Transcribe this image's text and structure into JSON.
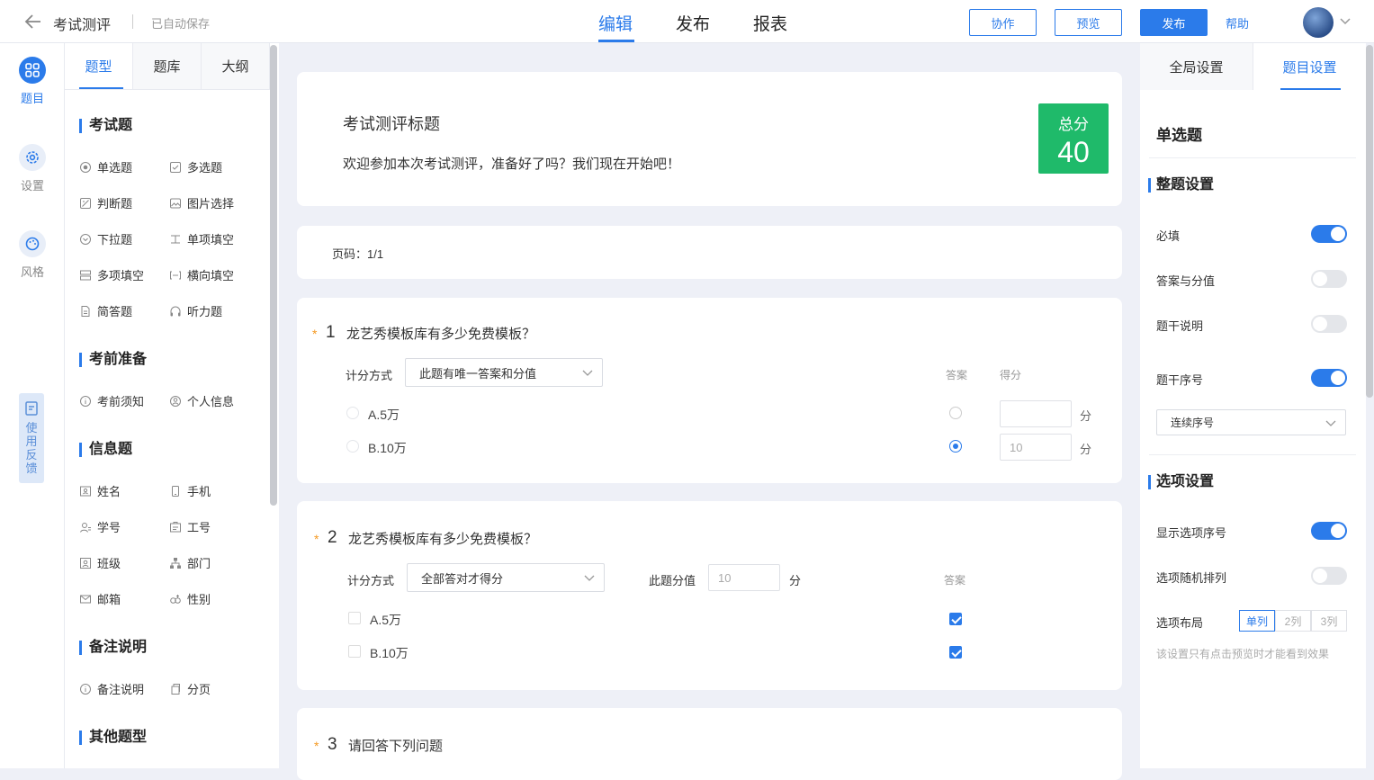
{
  "header": {
    "title": "考试测评",
    "autosave": "已自动保存",
    "tabs": [
      "编辑",
      "发布",
      "报表"
    ],
    "buttons": {
      "collab": "协作",
      "preview": "预览",
      "publish": "发布"
    },
    "help": "帮助"
  },
  "rail": {
    "items": [
      "题目",
      "设置",
      "风格"
    ],
    "feedback": "使用反馈"
  },
  "left_panel": {
    "tabs": [
      "题型",
      "题库",
      "大纲"
    ],
    "sections": {
      "exam": {
        "title": "考试题",
        "items": [
          "单选题",
          "多选题",
          "判断题",
          "图片选择",
          "下拉题",
          "单项填空",
          "多项填空",
          "横向填空",
          "简答题",
          "听力题"
        ]
      },
      "prep": {
        "title": "考前准备",
        "items": [
          "考前须知",
          "个人信息"
        ]
      },
      "info": {
        "title": "信息题",
        "items": [
          "姓名",
          "手机",
          "学号",
          "工号",
          "班级",
          "部门",
          "邮箱",
          "性别"
        ]
      },
      "note": {
        "title": "备注说明",
        "items": [
          "备注说明",
          "分页"
        ]
      },
      "other": {
        "title": "其他题型"
      }
    }
  },
  "survey": {
    "title": "考试测评标题",
    "desc": "欢迎参加本次考试测评，准备好了吗？我们现在开始吧！",
    "total_label": "总分",
    "total_value": "40",
    "page": "页码：1/1"
  },
  "q1": {
    "num": "1",
    "title": "龙艺秀模板库有多少免费模板？",
    "score_mode_label": "计分方式",
    "score_mode": "此题有唯一答案和分值",
    "col_answer": "答案",
    "col_score": "得分",
    "options": [
      {
        "label": "A.5万",
        "score": "",
        "unit": "分"
      },
      {
        "label": "B.10万",
        "score": "10",
        "unit": "分"
      }
    ]
  },
  "q2": {
    "num": "2",
    "title": "龙艺秀模板库有多少免费模板？",
    "score_mode_label": "计分方式",
    "score_mode": "全部答对才得分",
    "score_label": "此题分值",
    "score": "10",
    "unit": "分",
    "col_answer": "答案",
    "options": [
      {
        "label": "A.5万"
      },
      {
        "label": "B.10万"
      }
    ]
  },
  "q3": {
    "num": "3",
    "title": "请回答下列问题"
  },
  "right_panel": {
    "tabs": [
      "全局设置",
      "题目设置"
    ],
    "heading": "单选题",
    "sec1": "整题设置",
    "required": "必填",
    "answer_score": "答案与分值",
    "stem_desc": "题干说明",
    "stem_num": "题干序号",
    "num_mode": "连续序号",
    "sec2": "选项设置",
    "show_opt_num": "显示选项序号",
    "random_opt": "选项随机排列",
    "opt_layout": "选项布局",
    "layouts": [
      "单列",
      "2列",
      "3列"
    ],
    "hint": "该设置只有点击预览时才能看到效果"
  }
}
